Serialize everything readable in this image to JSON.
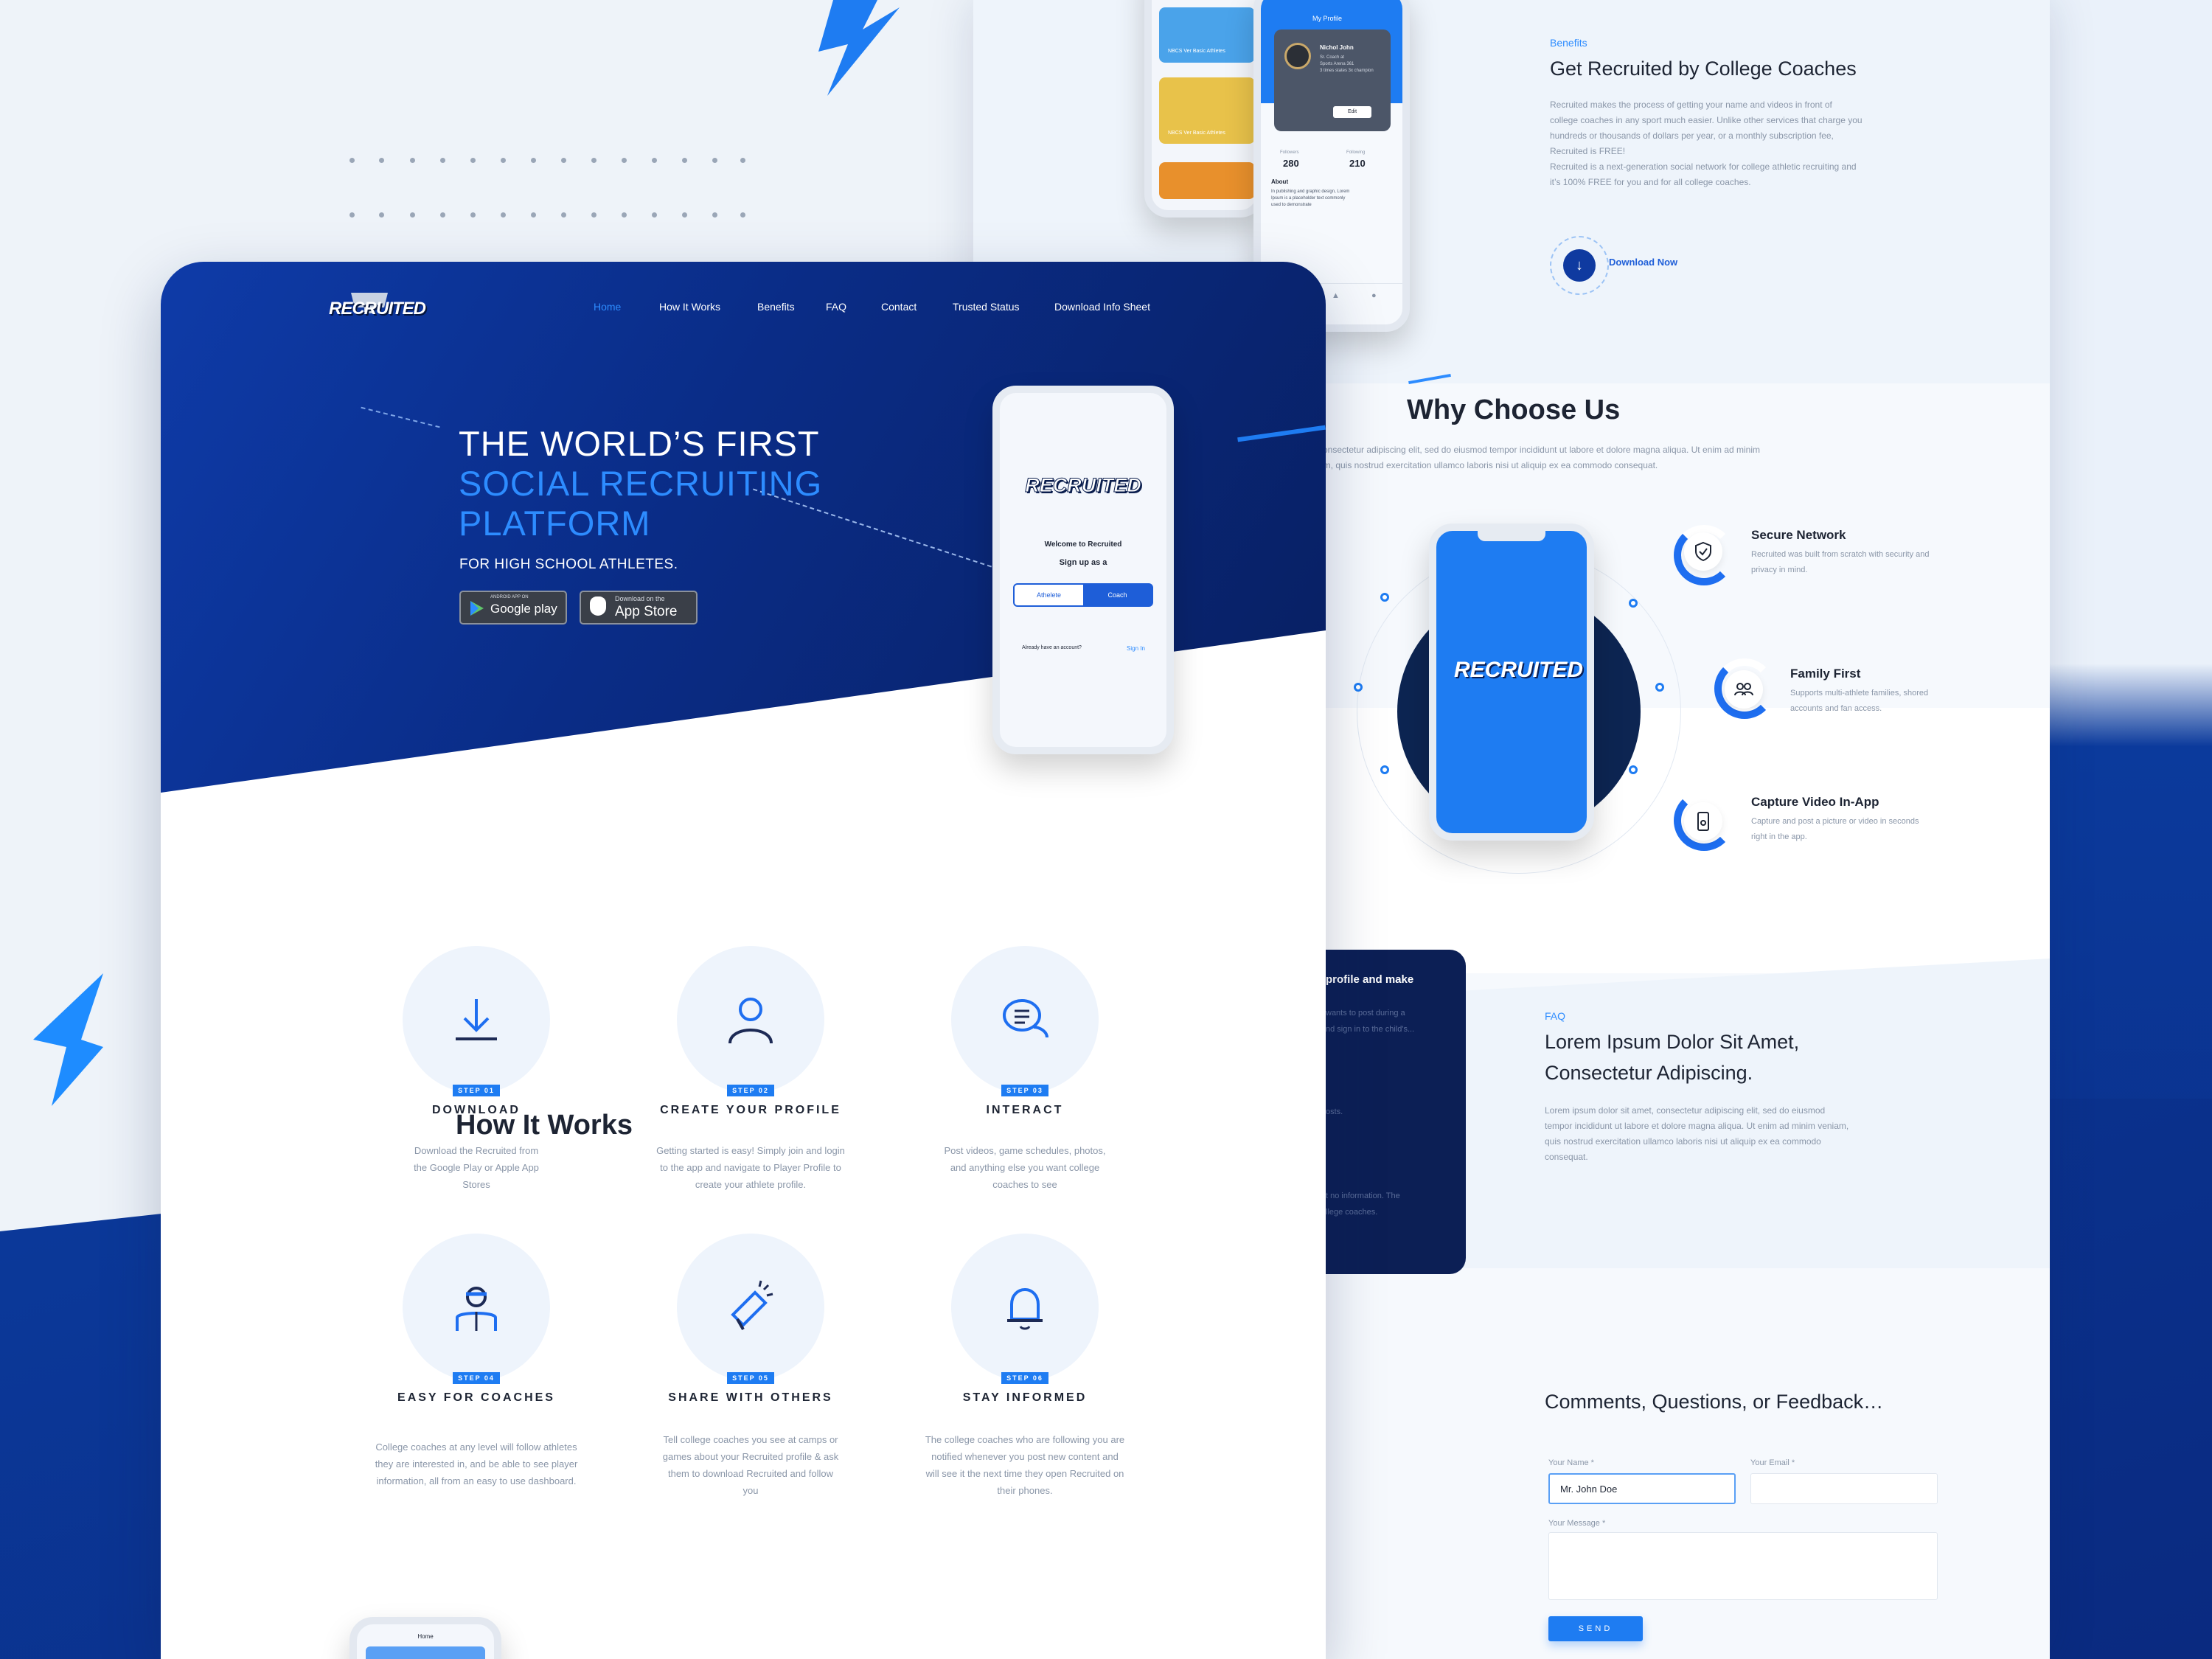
{
  "brand": {
    "logo_text": "RECRUITED",
    "accent": "#2d8cff",
    "navy": "#0a2c86"
  },
  "nav": {
    "items": [
      "Home",
      "How It Works",
      "Benefits",
      "FAQ",
      "Contact",
      "Trusted Status",
      "Download Info Sheet"
    ],
    "active": "Home"
  },
  "hero": {
    "line1": "THE WORLD’S FIRST",
    "line2": "SOCIAL RECRUITING",
    "line3": "PLATFORM",
    "subtitle": "FOR HIGH SCHOOL ATHLETES.",
    "google_small": "ANDROID APP ON",
    "google_big": "Google play",
    "apple_small": "Download on the",
    "apple_big": "App Store"
  },
  "hero_phone": {
    "logo_text": "RECRUITED",
    "welcome": "Welcome to Recruited",
    "signup": "Sign up as a",
    "option1": "Athelete",
    "option2": "Coach",
    "already": "Already have an account?",
    "signin": "Sign In"
  },
  "how_it_works": {
    "title": "How It Works",
    "steps": [
      {
        "badge": "STEP 01",
        "title": "DOWNLOAD",
        "icon": "download-icon",
        "desc": [
          "Download the Recruited from",
          "the Google Play or Apple App",
          "Stores"
        ]
      },
      {
        "badge": "STEP 02",
        "title": "CREATE YOUR PROFILE",
        "icon": "user-icon",
        "desc": [
          "Getting started is easy! Simply join and login",
          "to the app and navigate to Player Profile to",
          "create your athlete profile."
        ]
      },
      {
        "badge": "STEP 03",
        "title": "INTERACT",
        "icon": "chat-icon",
        "desc": [
          "Post videos, game schedules, photos,",
          "and anything else you want college",
          "coaches to see"
        ]
      },
      {
        "badge": "STEP 04",
        "title": "EASY FOR COACHES",
        "icon": "coach-icon",
        "desc": [
          "College coaches at any level will follow athletes",
          "they are interested in, and be able to see player",
          "information, all from an easy to use dashboard."
        ]
      },
      {
        "badge": "STEP 05",
        "title": "SHARE WITH OTHERS",
        "icon": "megaphone-icon",
        "desc": [
          "Tell college coaches you see at camps or",
          "games about your Recruited profile & ask",
          "them to download Recruited and follow",
          "you"
        ]
      },
      {
        "badge": "STEP 06",
        "title": "STAY INFORMED",
        "icon": "bell-icon",
        "desc": [
          "The college coaches who are following you are",
          "notified whenever you post new content and",
          "will see it the next time they open Recruited on",
          "their phones."
        ]
      }
    ]
  },
  "bottom_phone": {
    "label": "Home"
  },
  "profile_phone": {
    "title": "My Profile",
    "name": "Nichol John",
    "meta": [
      "Sr. Coach at",
      "Sports Arena 361",
      "3 times states 3x champion"
    ],
    "edit": "Edit",
    "followers_label": "Followers",
    "followers": "280",
    "following_label": "Following",
    "following": "210",
    "about_title": "About",
    "about": [
      "In publishing and graphic design, Lorem",
      "Ipsum is a placeholder text commonly",
      "used to demonstrate"
    ],
    "card1": "NBCS Ver Basic Athletes",
    "card2": "NBCS Ver Basic Athletes"
  },
  "benefits": {
    "tag": "Benefits",
    "title": "Get Recruited by College Coaches",
    "body": [
      "Recruited makes the process of getting your name and videos in front of",
      "college coaches in any sport much easier. Unlike other services that charge you",
      "hundreds or thousands of dollars per year, or a monthly subscription fee,",
      "Recruited is FREE!",
      "Recruited is a next-generation social network for college athletic recruiting and",
      "it’s 100% FREE for you and for all college coaches."
    ],
    "cta": "Download Now"
  },
  "why": {
    "title": "Why Choose Us",
    "body": [
      "consectetur adipiscing elit, sed do eiusmod tempor incididunt ut labore et dolore magna aliqua. Ut enim ad minim",
      "am, quis nostrud exercitation ullamco laboris nisi ut aliquip ex ea commodo consequat."
    ],
    "features": [
      {
        "title": "Secure Network",
        "icon": "shield-icon",
        "desc": [
          "Recruited was built from scratch with security and",
          "privacy in mind."
        ]
      },
      {
        "title": "Family First",
        "icon": "family-icon",
        "desc": [
          "Supports multi-athlete families, shored",
          "accounts and fan access."
        ]
      },
      {
        "title": "Capture Video In-App",
        "icon": "phone-video-icon",
        "desc": [
          "Capture and post a picture or video in seconds",
          "right in the app."
        ]
      }
    ],
    "phone_logo": "RECRUITED"
  },
  "dark_card": {
    "heading": "profile and make",
    "lines": [
      "wants to post during a",
      "nd sign in to the child's...",
      "osts.",
      "t no information. The",
      "llege coaches."
    ]
  },
  "faq": {
    "tag": "FAQ",
    "title1": "Lorem Ipsum Dolor Sit Amet,",
    "title2": "Consectetur Adipiscing.",
    "body": [
      "Lorem ipsum dolor sit amet, consectetur adipiscing elit, sed do eiusmod",
      "tempor incididunt ut labore et dolore magna aliqua. Ut enim ad minim veniam,",
      "quis nostrud exercitation ullamco laboris nisi ut aliquip ex ea commodo",
      "consequat."
    ]
  },
  "contact": {
    "title": "Comments, Questions, or Feedback…",
    "name_label": "Your Name *",
    "name_value": "Mr. John Doe",
    "email_label": "Your Email *",
    "message_label": "Your Message *",
    "send": "SEND"
  }
}
